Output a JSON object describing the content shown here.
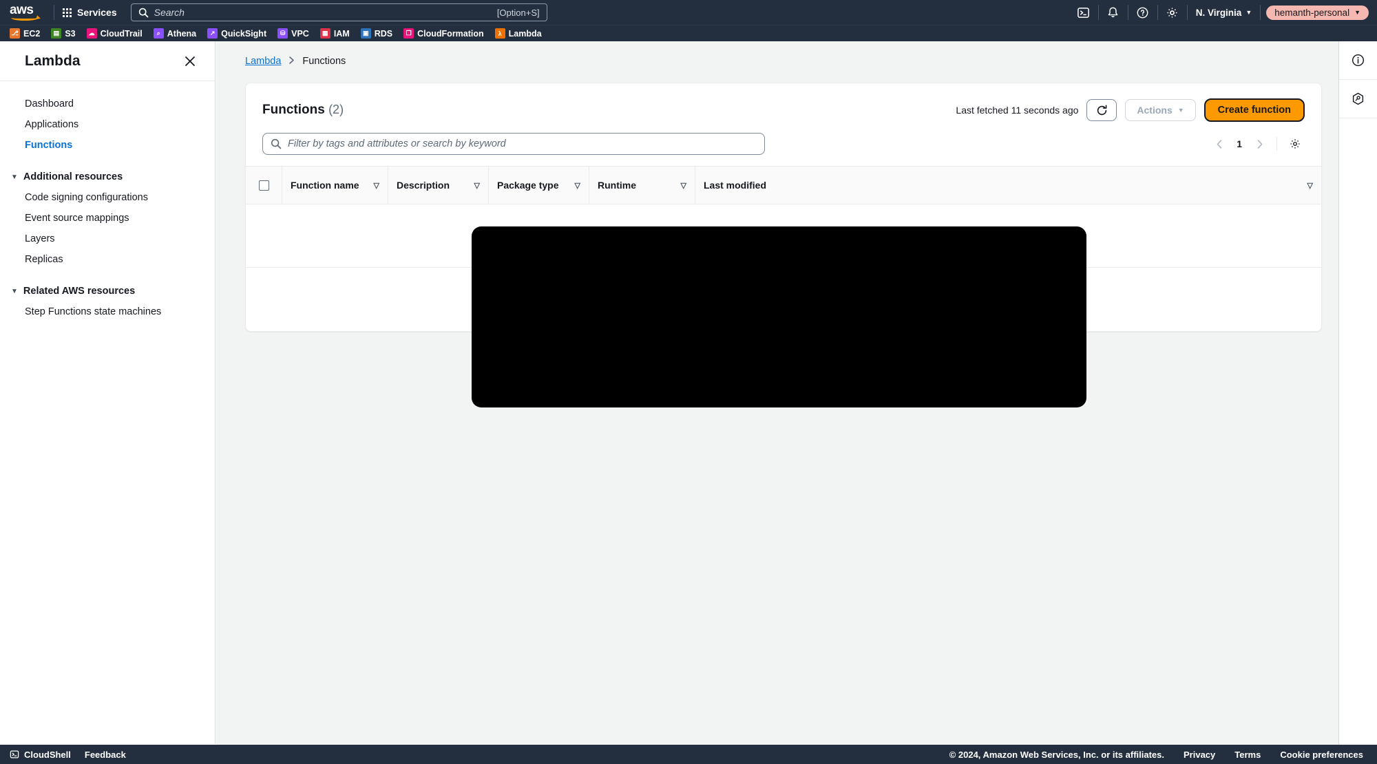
{
  "topnav": {
    "logo_text": "aws",
    "logo_name": "aws-logo",
    "services_label": "Services",
    "search": {
      "placeholder": "Search",
      "shortcut": "[Option+S]",
      "icon": "search-icon"
    },
    "icons": [
      {
        "name": "cloudshell-icon",
        "glyph": ">_"
      },
      {
        "name": "notifications-bell-icon",
        "glyph": "bell"
      },
      {
        "name": "help-question-icon",
        "glyph": "?"
      },
      {
        "name": "settings-gear-icon",
        "glyph": "gear"
      }
    ],
    "region_label": "N. Virginia",
    "account_label": "hemanth-personal",
    "caret": "▼"
  },
  "shortcuts": [
    {
      "label": "EC2",
      "color": "#e8762d",
      "glyph": "⎇"
    },
    {
      "label": "S3",
      "color": "#3f8624",
      "glyph": "▤"
    },
    {
      "label": "CloudTrail",
      "color": "#e7157b",
      "glyph": "☁"
    },
    {
      "label": "Athena",
      "color": "#8c4fff",
      "glyph": "⌕"
    },
    {
      "label": "QuickSight",
      "color": "#8c4fff",
      "glyph": "↗"
    },
    {
      "label": "VPC",
      "color": "#8c4fff",
      "glyph": "⛁"
    },
    {
      "label": "IAM",
      "color": "#dd344c",
      "glyph": "▦"
    },
    {
      "label": "RDS",
      "color": "#2e73b8",
      "glyph": "▣"
    },
    {
      "label": "CloudFormation",
      "color": "#e7157b",
      "glyph": "❐"
    },
    {
      "label": "Lambda",
      "color": "#ed7100",
      "glyph": "λ"
    }
  ],
  "sidebar": {
    "title": "Lambda",
    "close_icon": "close-icon",
    "items": [
      {
        "label": "Dashboard",
        "active": false
      },
      {
        "label": "Applications",
        "active": false
      },
      {
        "label": "Functions",
        "active": true
      }
    ],
    "groups": [
      {
        "label": "Additional resources",
        "caret": "▼",
        "items": [
          {
            "label": "Code signing configurations"
          },
          {
            "label": "Event source mappings"
          },
          {
            "label": "Layers"
          },
          {
            "label": "Replicas"
          }
        ]
      },
      {
        "label": "Related AWS resources",
        "caret": "▼",
        "items": [
          {
            "label": "Step Functions state machines"
          }
        ]
      }
    ]
  },
  "rightpanel": {
    "buttons": [
      {
        "name": "info-panel-icon",
        "label": "i"
      },
      {
        "name": "shortcuts-panel-icon",
        "label": "⚙"
      }
    ]
  },
  "main": {
    "breadcrumb": {
      "root": "Lambda",
      "separator": "›",
      "current": "Functions"
    },
    "panel": {
      "title": "Functions",
      "count": "(2)",
      "last_fetched": "Last fetched 11 seconds ago",
      "refresh_icon": "refresh-icon",
      "actions_label": "Actions",
      "actions_caret": "▼",
      "create_label": "Create function"
    },
    "filter": {
      "placeholder": "Filter by tags and attributes or search by keyword",
      "icon": "search-icon",
      "value": ""
    },
    "pagination": {
      "prev": "‹",
      "page": "1",
      "next": "›",
      "settings_icon": "table-preferences-gear-icon"
    },
    "table": {
      "select_all": "select-all-checkbox",
      "columns": [
        {
          "label": "Function name",
          "sortable": true
        },
        {
          "label": "Description",
          "sortable": true
        },
        {
          "label": "Package type",
          "sortable": true
        },
        {
          "label": "Runtime",
          "sortable": true
        },
        {
          "label": "Last modified",
          "sortable": true
        }
      ],
      "sort_icon": "▽",
      "rows": [
        {
          "redacted": true
        },
        {
          "redacted": true
        }
      ],
      "redaction_note": "redacted-black-overlay"
    }
  },
  "footer": {
    "cloudshell_label": "CloudShell",
    "cloudshell_icon": "cloudshell-icon",
    "feedback_label": "Feedback",
    "copyright": "© 2024, Amazon Web Services, Inc. or its affiliates.",
    "links": [
      {
        "label": "Privacy"
      },
      {
        "label": "Terms"
      },
      {
        "label": "Cookie preferences"
      }
    ]
  },
  "colors": {
    "nav_bg": "#232f3e",
    "accent_orange": "#ff9900",
    "link_blue": "#0972d3",
    "account_pill": "#f5b8b0",
    "page_bg": "#f2f3f3"
  }
}
